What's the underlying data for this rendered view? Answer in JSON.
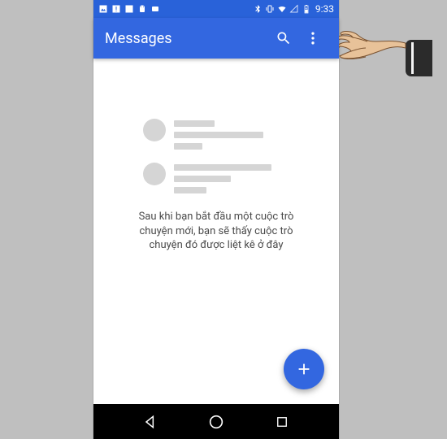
{
  "status": {
    "time": "9:33",
    "icons": {
      "picture": "picture-icon",
      "warning": "warning-icon",
      "square": "app-icon",
      "android": "android-icon",
      "debug": "debug-icon",
      "bluetooth": "bluetooth-icon",
      "vibrate": "vibrate-icon",
      "wifi": "wifi-icon",
      "signal": "signal-icon",
      "battery": "battery-icon"
    }
  },
  "app_bar": {
    "title": "Messages",
    "search_icon": "search-icon",
    "overflow_icon": "more-icon"
  },
  "empty_state": {
    "message": "Sau khi bạn bắt đầu một cuộc trò chuyện mới, bạn sẽ thấy cuộc trò chuyện đó được liệt kê ở đây"
  },
  "fab": {
    "icon": "plus-icon"
  },
  "nav": {
    "back": "back-icon",
    "home": "home-icon",
    "recent": "recent-icon"
  },
  "colors": {
    "primary": "#3367e0",
    "status_bar": "#2962d9",
    "placeholder": "#d5d5d5"
  }
}
